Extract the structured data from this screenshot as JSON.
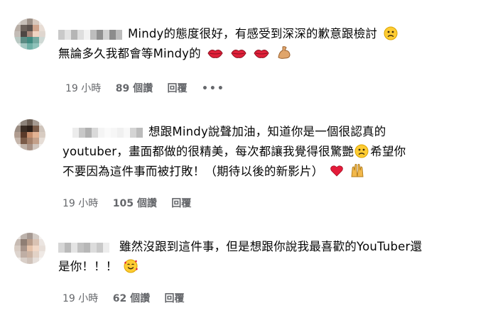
{
  "comments": [
    {
      "lines": [
        "Mindy的態度很好，有感受到深深的歉意跟檢討",
        "無論多久我都會等Mindy的"
      ],
      "time": "19 小時",
      "likes": "89 個讚",
      "reply": "回覆",
      "more": "•••"
    },
    {
      "lines": [
        "想跟Mindy說聲加油，知道你是一個很認真的",
        "youtuber，畫面都做的很精美，每次都讓我覺得很驚艷",
        "不要因為這件事而被打敗！（期待以後的新影片）"
      ],
      "line2_tail": "希望你",
      "time": "19 小時",
      "likes": "105 個讚",
      "reply": "回覆"
    },
    {
      "lines": [
        "雖然沒跟到這件事，但是想跟你說我最喜歡的YouTuber還",
        "是你！！！"
      ],
      "time": "19 小時",
      "likes": "62 個讚",
      "reply": "回覆"
    }
  ]
}
